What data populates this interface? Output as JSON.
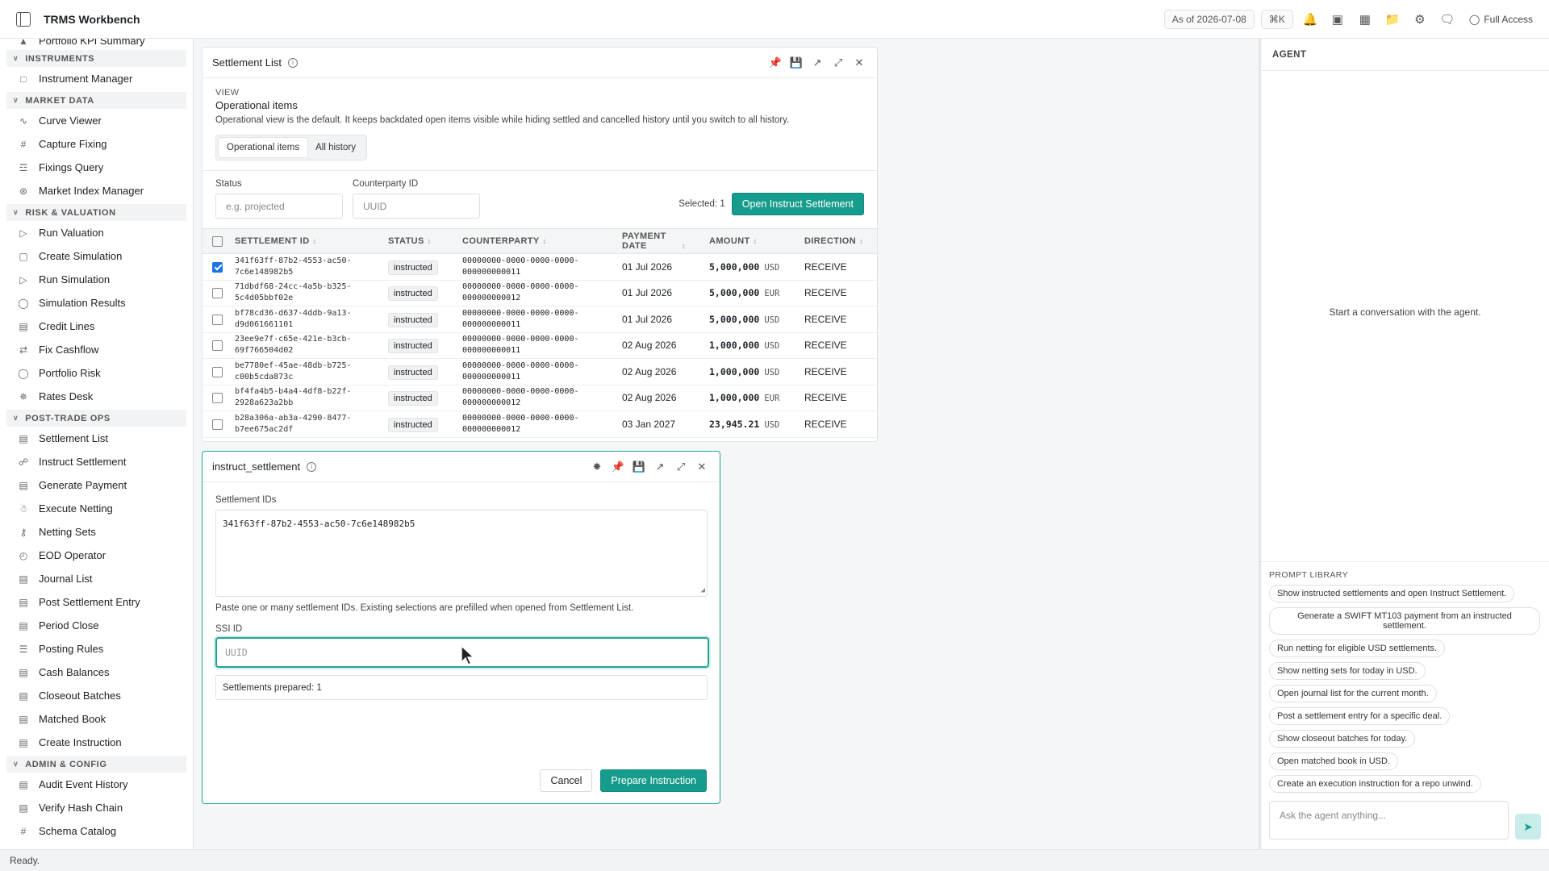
{
  "app": {
    "title": "TRMS Workbench",
    "as_of": "As of 2026-07-08",
    "shortcut": "⌘K",
    "access": "Full Access"
  },
  "sidebar": {
    "partial_top": "Portfolio KPI Summary",
    "sections": [
      {
        "label": "INSTRUMENTS",
        "items": [
          "Instrument Manager"
        ]
      },
      {
        "label": "MARKET DATA",
        "items": [
          "Curve Viewer",
          "Capture Fixing",
          "Fixings Query",
          "Market Index Manager"
        ]
      },
      {
        "label": "RISK & VALUATION",
        "items": [
          "Run Valuation",
          "Create Simulation",
          "Run Simulation",
          "Simulation Results",
          "Credit Lines",
          "Fix Cashflow",
          "Portfolio Risk",
          "Rates Desk"
        ]
      },
      {
        "label": "POST-TRADE OPS",
        "items": [
          "Settlement List",
          "Instruct Settlement",
          "Generate Payment",
          "Execute Netting",
          "Netting Sets",
          "EOD Operator",
          "Journal List",
          "Post Settlement Entry",
          "Period Close",
          "Posting Rules",
          "Cash Balances",
          "Closeout Batches",
          "Matched Book",
          "Create Instruction"
        ]
      },
      {
        "label": "ADMIN & CONFIG",
        "items": [
          "Audit Event History",
          "Verify Hash Chain",
          "Schema Catalog"
        ]
      }
    ]
  },
  "settlement": {
    "title": "Settlement List",
    "view_label": "VIEW",
    "view_name": "Operational items",
    "view_desc": "Operational view is the default. It keeps backdated open items visible while hiding settled and cancelled history until you switch to all history.",
    "tabs": [
      "Operational items",
      "All history"
    ],
    "status_label": "Status",
    "status_placeholder": "e.g. projected",
    "cp_label": "Counterparty ID",
    "cp_placeholder": "UUID",
    "selected": "Selected: 1",
    "open_btn": "Open Instruct Settlement",
    "columns": [
      "SETTLEMENT ID",
      "STATUS",
      "COUNTERPARTY",
      "PAYMENT DATE",
      "AMOUNT",
      "DIRECTION"
    ],
    "rows": [
      {
        "checked": true,
        "id1": "341f63ff-87b2-4553-ac50-",
        "id2": "7c6e148982b5",
        "status": "instructed",
        "cp1": "00000000-0000-0000-0000-",
        "cp2": "000000000011",
        "date": "01 Jul 2026",
        "amount": "5,000,000",
        "ccy": "USD",
        "dir": "RECEIVE"
      },
      {
        "checked": false,
        "id1": "71dbdf68-24cc-4a5b-b325-",
        "id2": "5c4d05bbf02e",
        "status": "instructed",
        "cp1": "00000000-0000-0000-0000-",
        "cp2": "000000000012",
        "date": "01 Jul 2026",
        "amount": "5,000,000",
        "ccy": "EUR",
        "dir": "RECEIVE"
      },
      {
        "checked": false,
        "id1": "bf78cd36-d637-4ddb-9a13-",
        "id2": "d9d061661101",
        "status": "instructed",
        "cp1": "00000000-0000-0000-0000-",
        "cp2": "000000000011",
        "date": "01 Jul 2026",
        "amount": "5,000,000",
        "ccy": "USD",
        "dir": "RECEIVE"
      },
      {
        "checked": false,
        "id1": "23ee9e7f-c65e-421e-b3cb-",
        "id2": "69f766504d02",
        "status": "instructed",
        "cp1": "00000000-0000-0000-0000-",
        "cp2": "000000000011",
        "date": "02 Aug 2026",
        "amount": "1,000,000",
        "ccy": "USD",
        "dir": "RECEIVE"
      },
      {
        "checked": false,
        "id1": "be7780ef-45ae-48db-b725-",
        "id2": "c00b5cda873c",
        "status": "instructed",
        "cp1": "00000000-0000-0000-0000-",
        "cp2": "000000000011",
        "date": "02 Aug 2026",
        "amount": "1,000,000",
        "ccy": "USD",
        "dir": "RECEIVE"
      },
      {
        "checked": false,
        "id1": "bf4fa4b5-b4a4-4df8-b22f-",
        "id2": "2928a623a2bb",
        "status": "instructed",
        "cp1": "00000000-0000-0000-0000-",
        "cp2": "000000000012",
        "date": "02 Aug 2026",
        "amount": "1,000,000",
        "ccy": "EUR",
        "dir": "RECEIVE"
      },
      {
        "checked": false,
        "id1": "b28a306a-ab3a-4290-8477-",
        "id2": "b7ee675ac2df",
        "status": "instructed",
        "cp1": "00000000-0000-0000-0000-",
        "cp2": "000000000012",
        "date": "03 Jan 2027",
        "amount": "23,945.21",
        "ccy": "USD",
        "dir": "RECEIVE"
      }
    ]
  },
  "instruct": {
    "title": "instruct_settlement",
    "ids_label": "Settlement IDs",
    "ids_value": "341f63ff-87b2-4553-ac50-7c6e148982b5",
    "hint": "Paste one or many settlement IDs. Existing selections are prefilled when opened from Settlement List.",
    "ssi_label": "SSI ID",
    "ssi_placeholder": "UUID",
    "prepared": "Settlements prepared: 1",
    "cancel": "Cancel",
    "prepare": "Prepare Instruction"
  },
  "agent": {
    "title": "AGENT",
    "empty": "Start a conversation with the agent.",
    "library_title": "PROMPT LIBRARY",
    "prompts": [
      "Show instructed settlements and open Instruct Settlement.",
      "Generate a SWIFT MT103 payment from an instructed settlement.",
      "Run netting for eligible USD settlements.",
      "Show netting sets for today in USD.",
      "Open journal list for the current month.",
      "Post a settlement entry for a specific deal.",
      "Show closeout batches for today.",
      "Open matched book in USD.",
      "Create an execution instruction for a repo unwind."
    ],
    "composer_placeholder": "Ask the agent anything..."
  },
  "status": "Ready.",
  "colors": {
    "accent": "#169c8c",
    "checkbox": "#1a73e8"
  }
}
